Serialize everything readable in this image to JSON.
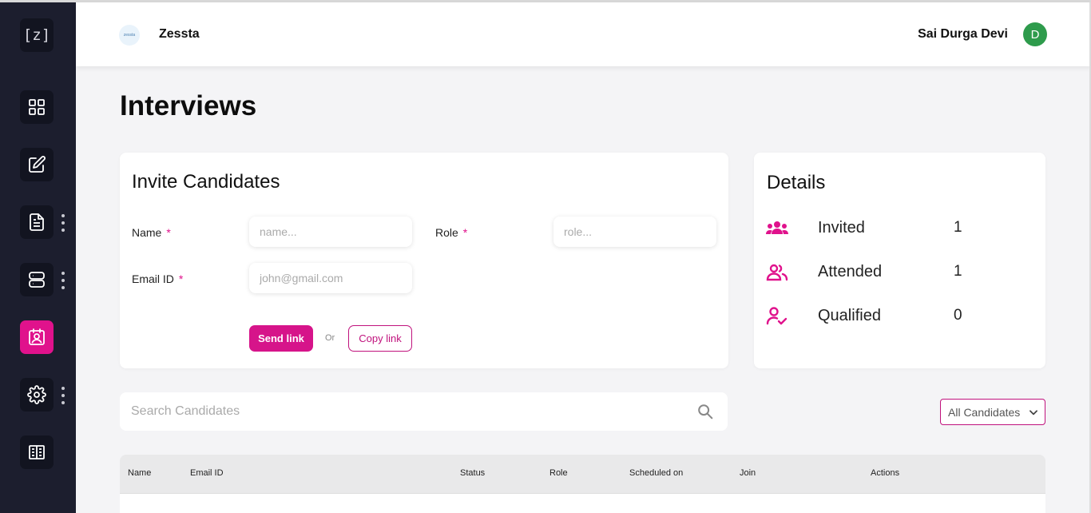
{
  "sidebar": {
    "logo": "[z]",
    "items": [
      {
        "icon": "dashboard-icon"
      },
      {
        "icon": "edit-icon"
      },
      {
        "icon": "document-icon"
      },
      {
        "icon": "server-icon"
      },
      {
        "icon": "interviews-icon",
        "active": true
      },
      {
        "icon": "settings-icon"
      },
      {
        "icon": "building-icon"
      }
    ]
  },
  "header": {
    "brand_logo_text": "zessta",
    "brand_name": "Zessta",
    "user_name": "Sai Durga Devi",
    "avatar_initial": "D"
  },
  "page": {
    "title": "Interviews"
  },
  "invite": {
    "title": "Invite Candidates",
    "name_label": "Name",
    "name_placeholder": "name...",
    "role_label": "Role",
    "role_placeholder": "role...",
    "email_label": "Email ID",
    "email_placeholder": "john@gmail.com",
    "required_mark": "*",
    "send_label": "Send link",
    "or_label": "Or",
    "copy_label": "Copy link"
  },
  "details": {
    "title": "Details",
    "rows": [
      {
        "label": "Invited",
        "value": "1",
        "icon": "invited-group-icon"
      },
      {
        "label": "Attended",
        "value": "1",
        "icon": "attended-users-icon"
      },
      {
        "label": "Qualified",
        "value": "0",
        "icon": "qualified-user-check-icon"
      }
    ]
  },
  "search": {
    "placeholder": "Search Candidates"
  },
  "filter": {
    "selected": "All Candidates"
  },
  "table": {
    "columns": [
      "Name",
      "Email ID",
      "Status",
      "Role",
      "Scheduled on",
      "Join",
      "Actions"
    ]
  },
  "colors": {
    "accent": "#e0128c",
    "sidebar_bg": "#1c1e2e",
    "avatar_bg": "#2e9b4c"
  }
}
